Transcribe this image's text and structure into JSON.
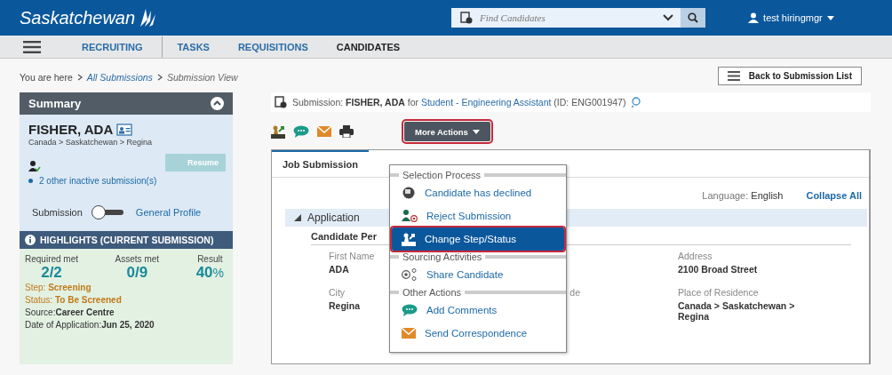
{
  "header": {
    "logo": "Saskatchewan",
    "search": {
      "placeholder": "Find Candidates"
    },
    "user": "test hiringmgr"
  },
  "nav": [
    {
      "label": "RECRUITING",
      "selected": false
    },
    {
      "label": "TASKS",
      "selected": false
    },
    {
      "label": "REQUISITIONS",
      "selected": false
    },
    {
      "label": "CANDIDATES",
      "selected": true
    }
  ],
  "breadcrumb": {
    "prefix": "You are here",
    "links": [
      "All Submissions",
      "Submission View"
    ]
  },
  "back_button": "Back to Submission List",
  "summary": {
    "title": "Summary",
    "name": "FISHER, ADA",
    "location": "Canada > Saskatchewan > Regina",
    "resume": {
      "label": "Resume",
      "disabled": true
    },
    "other_submissions": "2 other inactive submission(s)",
    "toggle": {
      "left": "Submission",
      "right": "General Profile",
      "on": false
    },
    "highlights_title": "HIGHLIGHTS (CURRENT SUBMISSION)",
    "stats": [
      {
        "label": "Required met",
        "value": "2/2"
      },
      {
        "label": "Assets met",
        "value": "0/9"
      },
      {
        "label": "Result",
        "value": "40",
        "unit": "%"
      }
    ],
    "details": [
      {
        "label": "Step: ",
        "value": "Screening",
        "kind": "status"
      },
      {
        "label": "Status: ",
        "value": "To Be Screened",
        "kind": "status"
      },
      {
        "label": "Source:",
        "value": "Career Centre",
        "kind": "info"
      },
      {
        "label": "Date of Application:",
        "value": "Jun 25, 2020",
        "kind": "info"
      }
    ]
  },
  "submission": {
    "prefix": "Submission: ",
    "candidate": "FISHER, ADA",
    "for": " for ",
    "job": "Student - Engineering Assistant",
    "id": " (ID: ENG001947)"
  },
  "more_actions": {
    "label": "More Actions",
    "highlighted": true,
    "menu": [
      {
        "kind": "header",
        "label": "Selection Process"
      },
      {
        "kind": "item",
        "label": "Candidate has declined",
        "selected": false
      },
      {
        "kind": "item",
        "label": "Reject Submission",
        "selected": false
      },
      {
        "kind": "item",
        "label": "Change Step/Status",
        "selected": true
      },
      {
        "kind": "header",
        "label": "Sourcing Activities"
      },
      {
        "kind": "item",
        "label": "Share Candidate",
        "selected": false
      },
      {
        "kind": "header",
        "label": "Other Actions"
      },
      {
        "kind": "item",
        "label": "Add Comments",
        "selected": false
      },
      {
        "kind": "item",
        "label": "Send Correspondence",
        "selected": false
      }
    ]
  },
  "tabs": [
    {
      "label": "Job Submission",
      "selected": true
    }
  ],
  "language": {
    "label": "Language:",
    "value": "English"
  },
  "collapse_all": "Collapse All",
  "section": {
    "title": "Application",
    "expanded": true,
    "subtitle": "Candidate Per"
  },
  "fields": [
    [
      {
        "kind": "field",
        "label": "First Name",
        "value": "ADA"
      },
      {
        "kind": "blank"
      },
      {
        "kind": "field",
        "label": "Address",
        "value": "2100 Broad Street"
      }
    ],
    [
      {
        "kind": "field",
        "label": "City",
        "value": "Regina"
      },
      {
        "kind": "field",
        "label": "de"
      },
      {
        "kind": "field",
        "label": "Place of Residence",
        "value": "Canada > Saskatchewan > Regina"
      }
    ]
  ]
}
